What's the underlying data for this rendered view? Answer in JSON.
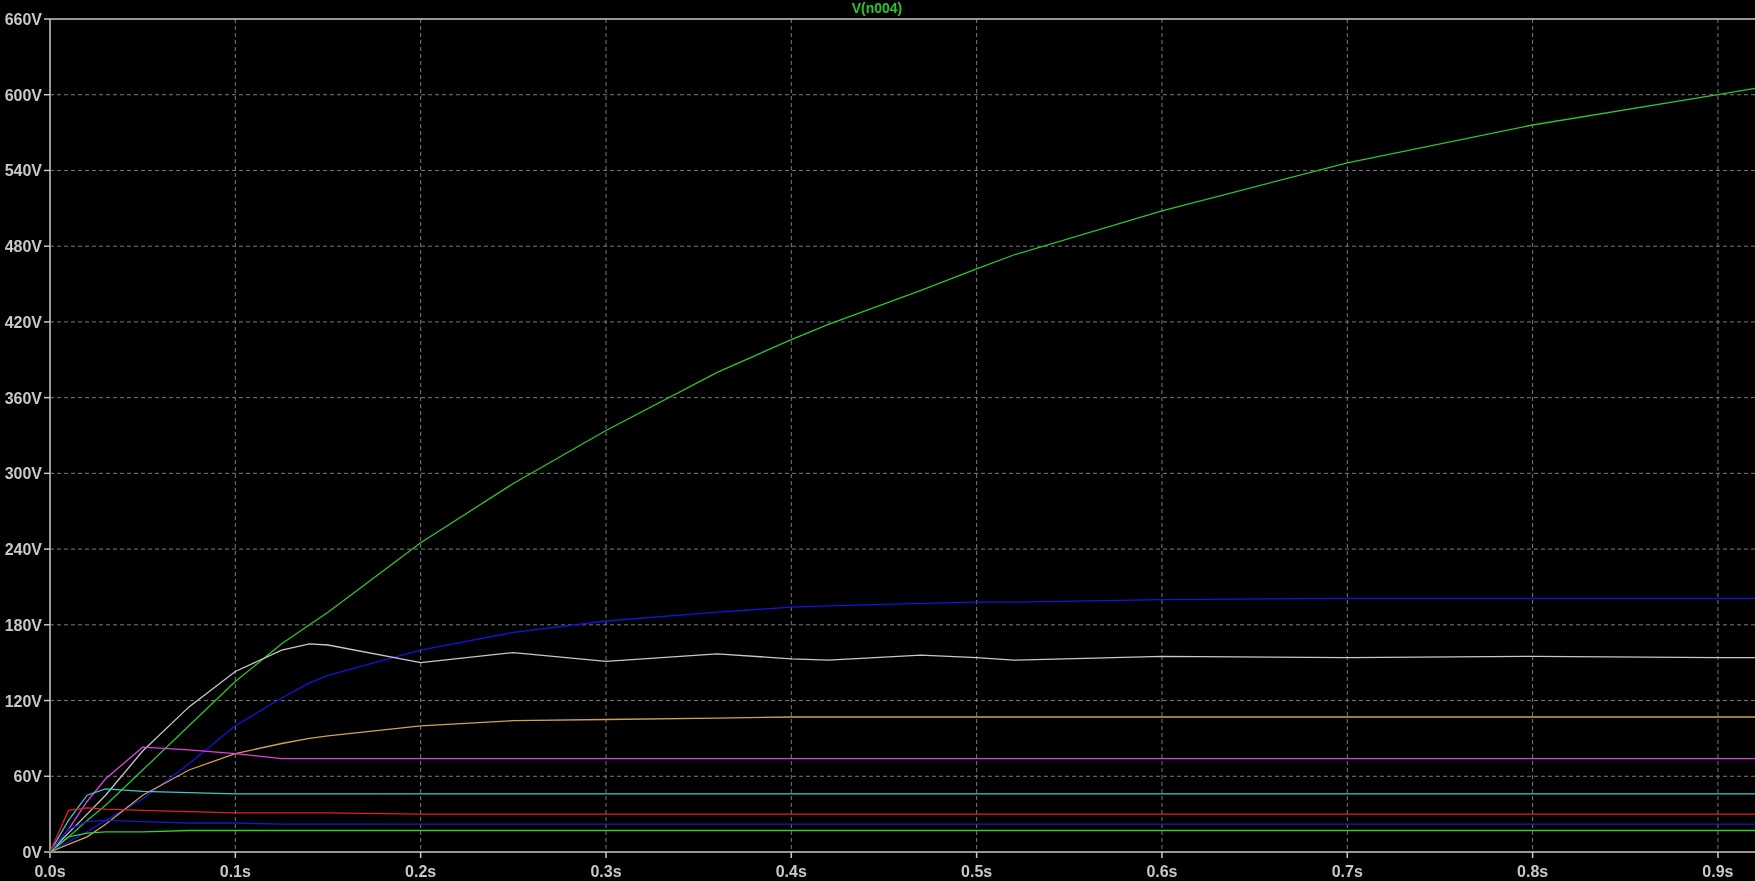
{
  "plot": {
    "chart_data": {
      "type": "line",
      "x": [
        0,
        0.01,
        0.02,
        0.03,
        0.05,
        0.075,
        0.1,
        0.125,
        0.14,
        0.15,
        0.2,
        0.25,
        0.3,
        0.36,
        0.4,
        0.42,
        0.47,
        0.5,
        0.52,
        0.6,
        0.7,
        0.8,
        0.9,
        0.92
      ],
      "series": [
        {
          "name": "V(n004)",
          "color": "#2ec42e",
          "values": [
            0,
            12,
            25,
            37,
            65,
            100,
            135,
            165,
            180,
            190,
            245,
            292,
            334,
            380,
            406,
            418,
            445,
            462,
            473,
            508,
            546,
            576,
            600,
            605
          ]
        },
        {
          "color": "#1414e0",
          "values": [
            0,
            8,
            16,
            25,
            42,
            70,
            100,
            122,
            134,
            140,
            160,
            174,
            183,
            190,
            194,
            195,
            197,
            198,
            198,
            200,
            201,
            201,
            201,
            201
          ]
        },
        {
          "color": "#c8c8c8",
          "values": [
            0,
            15,
            30,
            45,
            80,
            115,
            143,
            160,
            165,
            164,
            150,
            158,
            151,
            157,
            153,
            152,
            156,
            154,
            152,
            155,
            154,
            155,
            154,
            154
          ]
        },
        {
          "color": "#d4a050",
          "values": [
            0,
            6,
            12,
            22,
            45,
            65,
            78,
            86,
            90,
            92,
            100,
            104,
            105,
            106,
            107,
            107,
            107,
            107,
            107,
            107,
            107,
            107,
            107,
            107
          ]
        },
        {
          "color": "#e040e0",
          "values": [
            0,
            18,
            40,
            58,
            83,
            81,
            78,
            74,
            74,
            74,
            74,
            74,
            74,
            74,
            74,
            74,
            74,
            74,
            74,
            74,
            74,
            74,
            74,
            74
          ]
        },
        {
          "color": "#40c8c8",
          "values": [
            0,
            25,
            45,
            50,
            48,
            47,
            46,
            46,
            46,
            46,
            46,
            46,
            46,
            46,
            46,
            46,
            46,
            46,
            46,
            46,
            46,
            46,
            46,
            46
          ]
        },
        {
          "color": "#e02020",
          "values": [
            0,
            33,
            35,
            34,
            33,
            32,
            31,
            31,
            31,
            31,
            30,
            30,
            30,
            30,
            30,
            30,
            30,
            30,
            30,
            30,
            30,
            30,
            30,
            30
          ]
        },
        {
          "color": "#1818c8",
          "values": [
            0,
            18,
            24,
            25,
            24,
            23,
            23,
            22,
            22,
            22,
            22,
            22,
            22,
            22,
            22,
            22,
            22,
            22,
            22,
            22,
            22,
            22,
            22,
            22
          ]
        },
        {
          "color": "#30d030",
          "values": [
            0,
            12,
            15,
            16,
            16,
            17,
            17,
            17,
            17,
            17,
            17,
            17,
            17,
            17,
            17,
            17,
            17,
            17,
            17,
            17,
            17,
            17,
            17,
            17
          ]
        }
      ],
      "grid": true,
      "xlim": [
        0,
        0.92
      ],
      "ylim": [
        0,
        660
      ],
      "xticks": [
        {
          "value": 0,
          "label": "0.0s"
        },
        {
          "value": 0.1,
          "label": "0.1s"
        },
        {
          "value": 0.2,
          "label": "0.2s"
        },
        {
          "value": 0.3,
          "label": "0.3s"
        },
        {
          "value": 0.4,
          "label": "0.4s"
        },
        {
          "value": 0.5,
          "label": "0.5s"
        },
        {
          "value": 0.6,
          "label": "0.6s"
        },
        {
          "value": 0.7,
          "label": "0.7s"
        },
        {
          "value": 0.8,
          "label": "0.8s"
        },
        {
          "value": 0.9,
          "label": "0.9s"
        }
      ],
      "yticks": [
        {
          "value": 0,
          "label": "0V"
        },
        {
          "value": 60,
          "label": "60V"
        },
        {
          "value": 120,
          "label": "120V"
        },
        {
          "value": 180,
          "label": "180V"
        },
        {
          "value": 240,
          "label": "240V"
        },
        {
          "value": 300,
          "label": "300V"
        },
        {
          "value": 360,
          "label": "360V"
        },
        {
          "value": 420,
          "label": "420V"
        },
        {
          "value": 480,
          "label": "480V"
        },
        {
          "value": 540,
          "label": "540V"
        },
        {
          "value": 600,
          "label": "600V"
        },
        {
          "value": 660,
          "label": "660V"
        }
      ]
    }
  }
}
